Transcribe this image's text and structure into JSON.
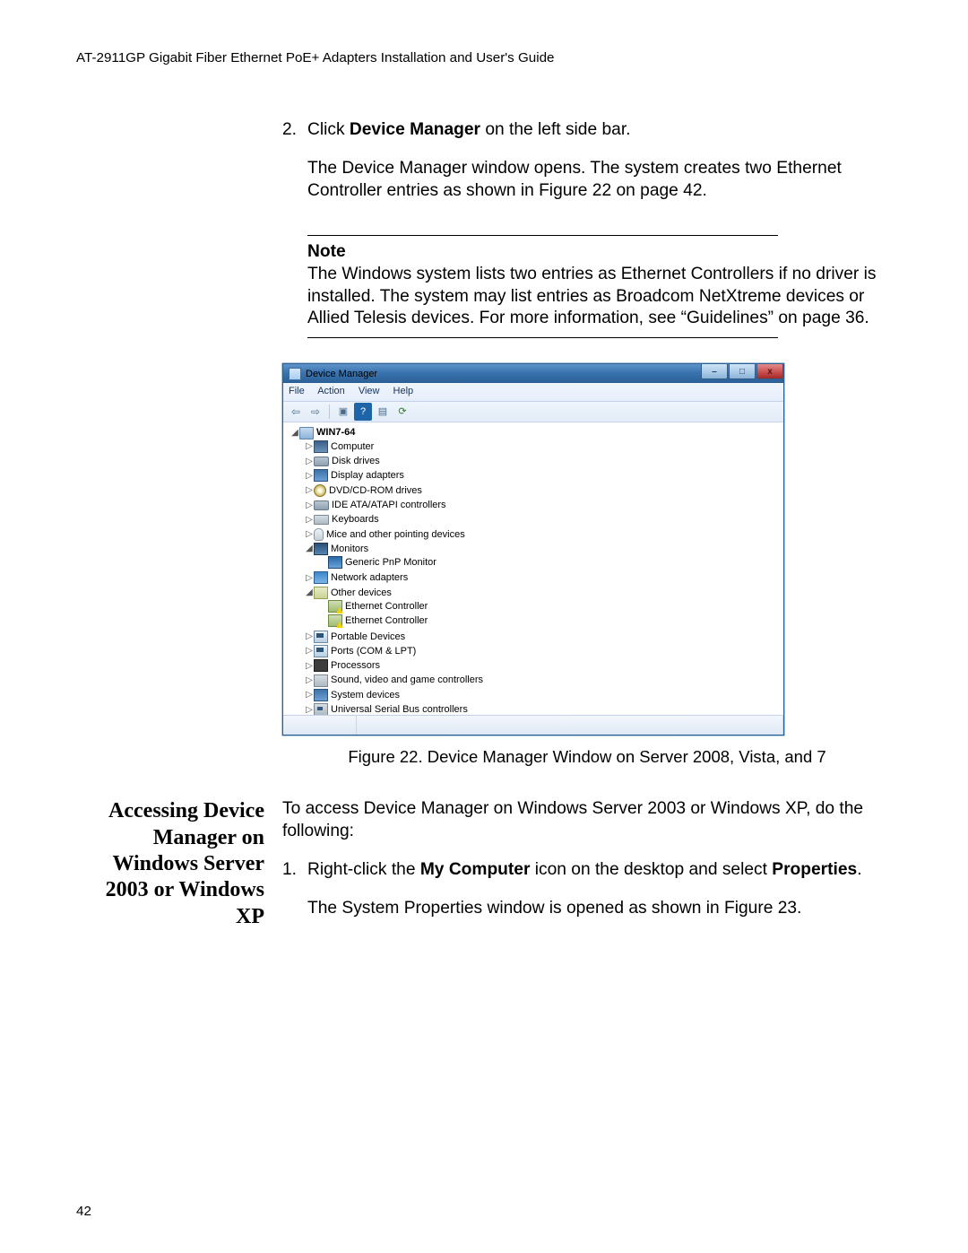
{
  "header": "AT-2911GP Gigabit Fiber Ethernet PoE+ Adapters Installation and User's Guide",
  "page_number": "42",
  "step2": {
    "num": "2.",
    "line": "Click <b>Device Manager</b> on the left side bar.",
    "para": "The Device Manager window opens. The system creates two Ethernet Controller entries as shown in Figure 22 on page 42."
  },
  "note": {
    "title": "Note",
    "body": "The Windows system lists two entries as Ethernet Controllers if no driver is installed. The system may list entries as Broadcom NetXtreme devices or Allied Telesis devices. For more information, see “Guidelines” on page 36."
  },
  "dm": {
    "title": "Device Manager",
    "menus": {
      "file": "File",
      "action": "Action",
      "view": "View",
      "help": "Help"
    },
    "toolbar": {
      "back": "⇦",
      "fwd": "⇨",
      "props": "▣",
      "help": "?",
      "tree": "▤",
      "scan": "⟳"
    },
    "winbtns": {
      "min": "–",
      "max": "□",
      "close": "x"
    },
    "root": "WIN7-64",
    "items": {
      "computer": "Computer",
      "disk": "Disk drives",
      "display": "Display adapters",
      "dvd": "DVD/CD-ROM drives",
      "ide": "IDE ATA/ATAPI controllers",
      "keyboards": "Keyboards",
      "mice": "Mice and other pointing devices",
      "monitors": "Monitors",
      "genmon": "Generic PnP Monitor",
      "network": "Network adapters",
      "other": "Other devices",
      "eth1": "Ethernet Controller",
      "eth2": "Ethernet Controller",
      "portable": "Portable Devices",
      "ports": "Ports (COM & LPT)",
      "processors": "Processors",
      "sound": "Sound, video and game controllers",
      "system": "System devices",
      "usb": "Universal Serial Bus controllers"
    },
    "tw": {
      "open": "◢",
      "closed": "▷"
    }
  },
  "fig_caption": "Figure 22. Device Manager Window on Server 2008, Vista, and 7",
  "section2": {
    "heading": "Accessing Device Manager on Windows Server 2003 or Windows XP",
    "intro": "To access Device Manager on Windows Server 2003 or Windows XP, do the following:",
    "s1_num": "1.",
    "s1": "Right-click the <b>My Computer</b> icon on the desktop and select <b>Properties</b>.",
    "after": "The System Properties window is opened as shown in Figure 23."
  }
}
